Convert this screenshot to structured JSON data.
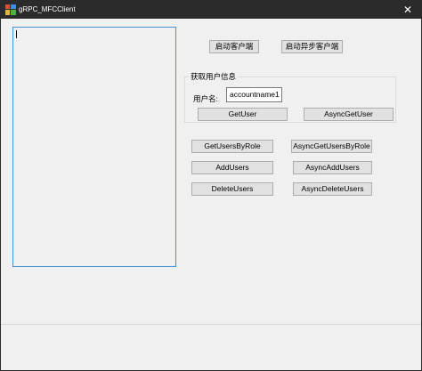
{
  "window": {
    "title": "gRPC_MFCClient",
    "close_glyph": "✕",
    "titlebar_color": "#2b2b2b",
    "accent_color": "#4a90d9"
  },
  "buttons": {
    "start_client": "启动客户端",
    "start_async_client": "启动异步客户端",
    "get_user": "GetUser",
    "async_get_user": "AsyncGetUser",
    "get_users_by_role": "GetUsersByRole",
    "async_get_users_by_role": "AsyncGetUsersByRole",
    "add_users": "AddUsers",
    "async_add_users": "AsyncAddUsers",
    "delete_users": "DeleteUsers",
    "async_delete_users": "AsyncDeleteUsers"
  },
  "user_info_group": {
    "title": "获取用户信息",
    "username_label": "用户名:",
    "username_value": "accountname1"
  },
  "log_output": {
    "text": ""
  }
}
